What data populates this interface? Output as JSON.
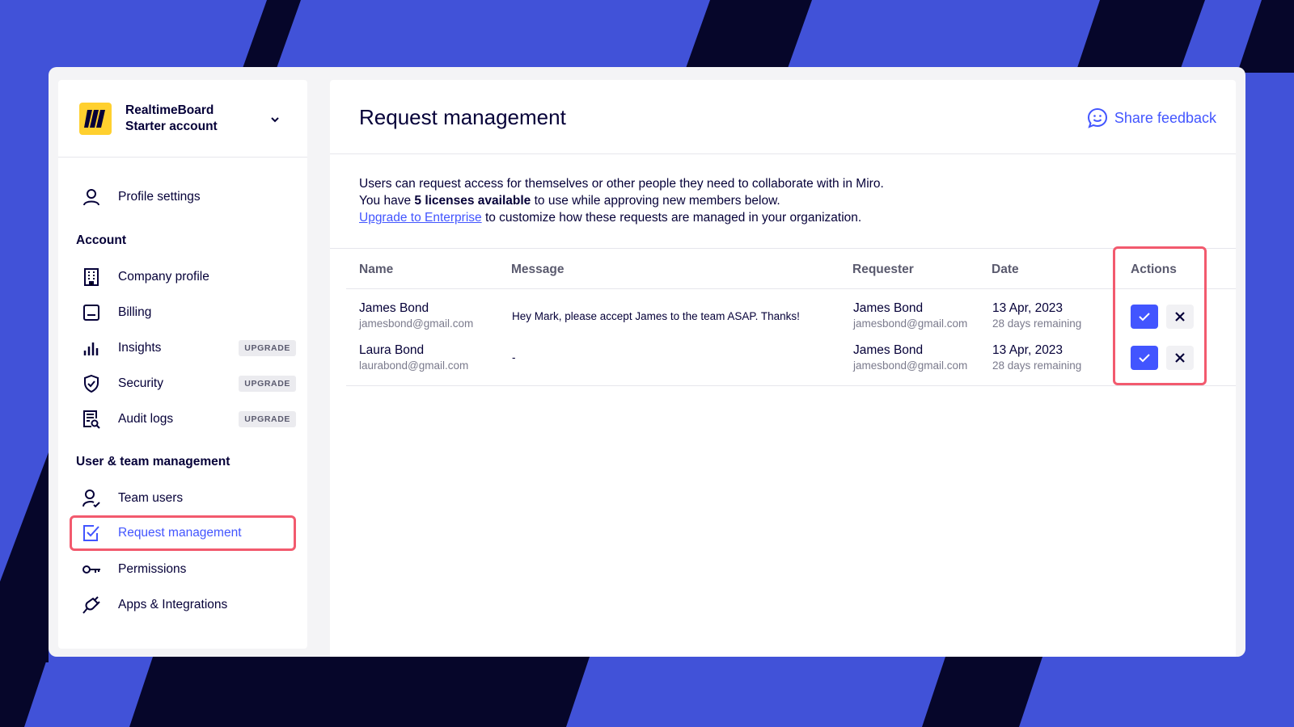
{
  "account": {
    "org_name": "RealtimeBoard",
    "plan": "Starter account"
  },
  "sidebar": {
    "profile_settings": "Profile settings",
    "account_section": "Account",
    "account_items": [
      {
        "label": "Company profile",
        "icon": "building-icon",
        "badge": ""
      },
      {
        "label": "Billing",
        "icon": "billing-icon",
        "badge": ""
      },
      {
        "label": "Insights",
        "icon": "bar-chart-icon",
        "badge": "UPGRADE"
      },
      {
        "label": "Security",
        "icon": "shield-icon",
        "badge": "UPGRADE"
      },
      {
        "label": "Audit logs",
        "icon": "audit-log-icon",
        "badge": "UPGRADE"
      }
    ],
    "team_section": "User & team management",
    "team_items": [
      {
        "label": "Team users",
        "icon": "user-check-icon"
      },
      {
        "label": "Request management",
        "icon": "checkbox-icon",
        "active": true
      },
      {
        "label": "Permissions",
        "icon": "key-icon"
      },
      {
        "label": "Apps & Integrations",
        "icon": "plug-icon"
      }
    ]
  },
  "main": {
    "title": "Request management",
    "share_feedback": "Share feedback",
    "intro": {
      "line1": "Users can request access for themselves or other people they need to collaborate with in Miro.",
      "line2_prefix": "You have ",
      "line2_bold": "5 licenses available",
      "line2_suffix": " to use while approving new members below.",
      "line3_link": "Upgrade to Enterprise",
      "line3_suffix": " to customize how these requests are managed in your organization."
    },
    "columns": [
      "Name",
      "Message",
      "Requester",
      "Date",
      "Actions"
    ],
    "rows": [
      {
        "name": "James Bond",
        "email": "jamesbond@gmail.com",
        "message": "Hey Mark, please accept James to the team ASAP. Thanks!",
        "requester": "James Bond",
        "requester_email": "jamesbond@gmail.com",
        "date": "13 Apr, 2023",
        "remaining": "28 days remaining"
      },
      {
        "name": "Laura Bond",
        "email": "laurabond@gmail.com",
        "message": "-",
        "requester": "James Bond",
        "requester_email": "jamesbond@gmail.com",
        "date": "13 Apr, 2023",
        "remaining": "28 days remaining"
      }
    ]
  },
  "colors": {
    "accent": "#4255ff",
    "highlight": "#f25a6e",
    "background": "#4152d8",
    "stripe": "#06062a",
    "logo": "#ffd02f"
  }
}
